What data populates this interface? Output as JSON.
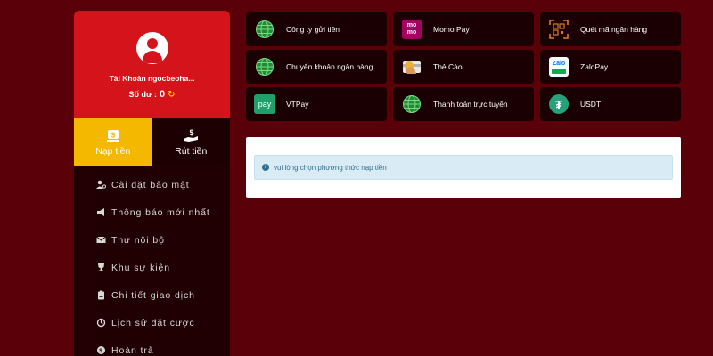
{
  "account": {
    "name": "Tài Khoản ngocbeoha...",
    "balance_label": "Số dư :",
    "balance_value": "0"
  },
  "actions": [
    {
      "label": "Nạp tiền",
      "icon": "money-bag-icon",
      "active": true
    },
    {
      "label": "Rút tiền",
      "icon": "hand-dollar-icon",
      "active": false
    }
  ],
  "menu": [
    {
      "label": "Cài đặt bảo mật",
      "icon": "user-gear-icon"
    },
    {
      "label": "Thông báo mới nhất",
      "icon": "megaphone-icon"
    },
    {
      "label": "Thư nội bộ",
      "icon": "envelope-icon"
    },
    {
      "label": "Khu sự kiện",
      "icon": "trophy-icon"
    },
    {
      "label": "Chi tiết giao dịch",
      "icon": "clipboard-icon"
    },
    {
      "label": "Lịch sử đặt cược",
      "icon": "history-icon"
    },
    {
      "label": "Hoàn trả",
      "icon": "refund-icon"
    }
  ],
  "payment_methods": [
    {
      "label": "Công ty gửi tiền",
      "icon": "globe-icon"
    },
    {
      "label": "Momo Pay",
      "icon": "momo-logo-icon",
      "logo_text": [
        "mo",
        "mo"
      ]
    },
    {
      "label": "Quét mã ngân hàng",
      "icon": "qr-scan-icon"
    },
    {
      "label": "Chuyển khoản ngân hàng",
      "icon": "globe-icon"
    },
    {
      "label": "Thẻ Cào",
      "icon": "scratch-card-icon"
    },
    {
      "label": "ZaloPay",
      "icon": "zalopay-logo-icon",
      "logo_text": "Zalo"
    },
    {
      "label": "VTPay",
      "icon": "vtpay-logo-icon",
      "logo_text": "pay"
    },
    {
      "label": "Thanh toán trực tuyến",
      "icon": "globe-icon"
    },
    {
      "label": "USDT",
      "icon": "tether-logo-icon",
      "logo_text": "₮"
    }
  ],
  "notice": {
    "message": "vui lòng chọn phương thức nạp tiền",
    "icon": "info-icon"
  },
  "colors": {
    "background": "#5a0008",
    "sidebar": "#200003",
    "account_card": "#d4141a",
    "active_tab": "#f5b800",
    "alert_bg": "#d9ecf5",
    "alert_text": "#2f6f8f"
  }
}
